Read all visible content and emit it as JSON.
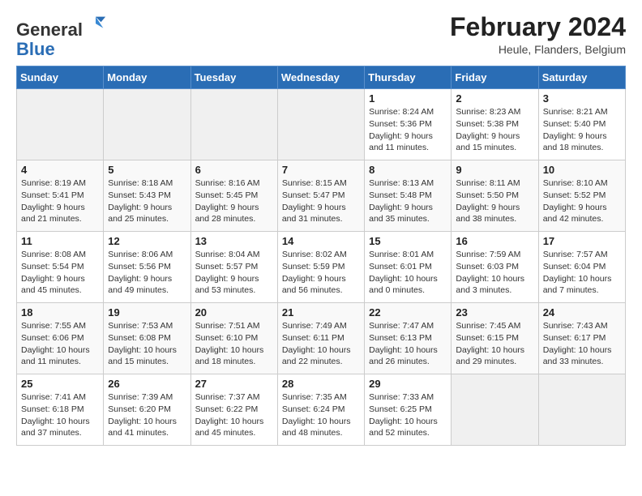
{
  "logo": {
    "general": "General",
    "blue": "Blue"
  },
  "header": {
    "title": "February 2024",
    "location": "Heule, Flanders, Belgium"
  },
  "weekdays": [
    "Sunday",
    "Monday",
    "Tuesday",
    "Wednesday",
    "Thursday",
    "Friday",
    "Saturday"
  ],
  "weeks": [
    [
      {
        "day": "",
        "info": ""
      },
      {
        "day": "",
        "info": ""
      },
      {
        "day": "",
        "info": ""
      },
      {
        "day": "",
        "info": ""
      },
      {
        "day": "1",
        "info": "Sunrise: 8:24 AM\nSunset: 5:36 PM\nDaylight: 9 hours\nand 11 minutes."
      },
      {
        "day": "2",
        "info": "Sunrise: 8:23 AM\nSunset: 5:38 PM\nDaylight: 9 hours\nand 15 minutes."
      },
      {
        "day": "3",
        "info": "Sunrise: 8:21 AM\nSunset: 5:40 PM\nDaylight: 9 hours\nand 18 minutes."
      }
    ],
    [
      {
        "day": "4",
        "info": "Sunrise: 8:19 AM\nSunset: 5:41 PM\nDaylight: 9 hours\nand 21 minutes."
      },
      {
        "day": "5",
        "info": "Sunrise: 8:18 AM\nSunset: 5:43 PM\nDaylight: 9 hours\nand 25 minutes."
      },
      {
        "day": "6",
        "info": "Sunrise: 8:16 AM\nSunset: 5:45 PM\nDaylight: 9 hours\nand 28 minutes."
      },
      {
        "day": "7",
        "info": "Sunrise: 8:15 AM\nSunset: 5:47 PM\nDaylight: 9 hours\nand 31 minutes."
      },
      {
        "day": "8",
        "info": "Sunrise: 8:13 AM\nSunset: 5:48 PM\nDaylight: 9 hours\nand 35 minutes."
      },
      {
        "day": "9",
        "info": "Sunrise: 8:11 AM\nSunset: 5:50 PM\nDaylight: 9 hours\nand 38 minutes."
      },
      {
        "day": "10",
        "info": "Sunrise: 8:10 AM\nSunset: 5:52 PM\nDaylight: 9 hours\nand 42 minutes."
      }
    ],
    [
      {
        "day": "11",
        "info": "Sunrise: 8:08 AM\nSunset: 5:54 PM\nDaylight: 9 hours\nand 45 minutes."
      },
      {
        "day": "12",
        "info": "Sunrise: 8:06 AM\nSunset: 5:56 PM\nDaylight: 9 hours\nand 49 minutes."
      },
      {
        "day": "13",
        "info": "Sunrise: 8:04 AM\nSunset: 5:57 PM\nDaylight: 9 hours\nand 53 minutes."
      },
      {
        "day": "14",
        "info": "Sunrise: 8:02 AM\nSunset: 5:59 PM\nDaylight: 9 hours\nand 56 minutes."
      },
      {
        "day": "15",
        "info": "Sunrise: 8:01 AM\nSunset: 6:01 PM\nDaylight: 10 hours\nand 0 minutes."
      },
      {
        "day": "16",
        "info": "Sunrise: 7:59 AM\nSunset: 6:03 PM\nDaylight: 10 hours\nand 3 minutes."
      },
      {
        "day": "17",
        "info": "Sunrise: 7:57 AM\nSunset: 6:04 PM\nDaylight: 10 hours\nand 7 minutes."
      }
    ],
    [
      {
        "day": "18",
        "info": "Sunrise: 7:55 AM\nSunset: 6:06 PM\nDaylight: 10 hours\nand 11 minutes."
      },
      {
        "day": "19",
        "info": "Sunrise: 7:53 AM\nSunset: 6:08 PM\nDaylight: 10 hours\nand 15 minutes."
      },
      {
        "day": "20",
        "info": "Sunrise: 7:51 AM\nSunset: 6:10 PM\nDaylight: 10 hours\nand 18 minutes."
      },
      {
        "day": "21",
        "info": "Sunrise: 7:49 AM\nSunset: 6:11 PM\nDaylight: 10 hours\nand 22 minutes."
      },
      {
        "day": "22",
        "info": "Sunrise: 7:47 AM\nSunset: 6:13 PM\nDaylight: 10 hours\nand 26 minutes."
      },
      {
        "day": "23",
        "info": "Sunrise: 7:45 AM\nSunset: 6:15 PM\nDaylight: 10 hours\nand 29 minutes."
      },
      {
        "day": "24",
        "info": "Sunrise: 7:43 AM\nSunset: 6:17 PM\nDaylight: 10 hours\nand 33 minutes."
      }
    ],
    [
      {
        "day": "25",
        "info": "Sunrise: 7:41 AM\nSunset: 6:18 PM\nDaylight: 10 hours\nand 37 minutes."
      },
      {
        "day": "26",
        "info": "Sunrise: 7:39 AM\nSunset: 6:20 PM\nDaylight: 10 hours\nand 41 minutes."
      },
      {
        "day": "27",
        "info": "Sunrise: 7:37 AM\nSunset: 6:22 PM\nDaylight: 10 hours\nand 45 minutes."
      },
      {
        "day": "28",
        "info": "Sunrise: 7:35 AM\nSunset: 6:24 PM\nDaylight: 10 hours\nand 48 minutes."
      },
      {
        "day": "29",
        "info": "Sunrise: 7:33 AM\nSunset: 6:25 PM\nDaylight: 10 hours\nand 52 minutes."
      },
      {
        "day": "",
        "info": ""
      },
      {
        "day": "",
        "info": ""
      }
    ]
  ]
}
